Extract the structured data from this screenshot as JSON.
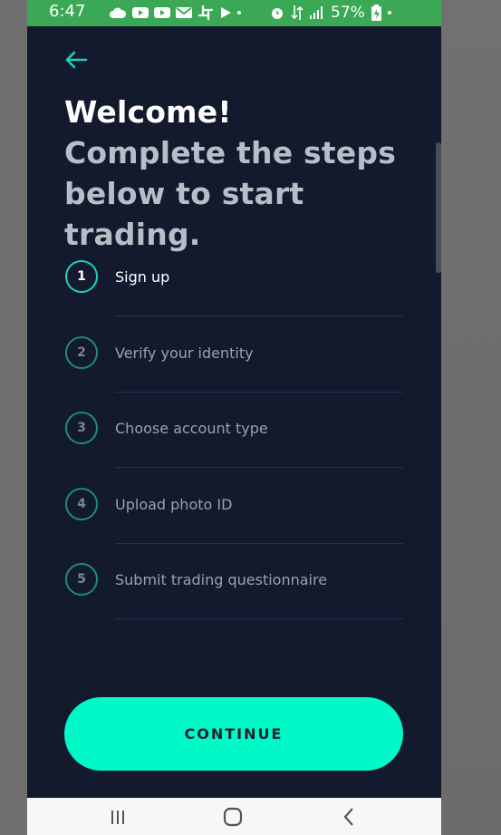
{
  "status_bar": {
    "time": "6:47",
    "battery": "57%",
    "icons": [
      "cloud-icon",
      "youtube-icon",
      "youtube-icon",
      "mail-icon",
      "slack-icon",
      "play-icon",
      "dot-icon",
      "alarm-icon",
      "data-icon",
      "signal-icon",
      "battery-icon"
    ]
  },
  "header": {
    "back_icon": "arrow-left-icon",
    "headline_strong": "Welcome!",
    "headline_rest": " Complete the steps below to start trading."
  },
  "steps": [
    {
      "number": "1",
      "label": "Sign up",
      "active": true
    },
    {
      "number": "2",
      "label": "Verify your identity",
      "active": false
    },
    {
      "number": "3",
      "label": "Choose account type",
      "active": false
    },
    {
      "number": "4",
      "label": "Upload photo ID",
      "active": false
    },
    {
      "number": "5",
      "label": "Submit trading questionnaire",
      "active": false
    }
  ],
  "continue_label": "CONTINUE",
  "nav_bar": {
    "icons": [
      "recent-apps-icon",
      "home-icon",
      "back-icon"
    ]
  },
  "colors": {
    "background": "#141a2e",
    "accent": "#00f9c7",
    "status_bar": "#3aa854"
  }
}
